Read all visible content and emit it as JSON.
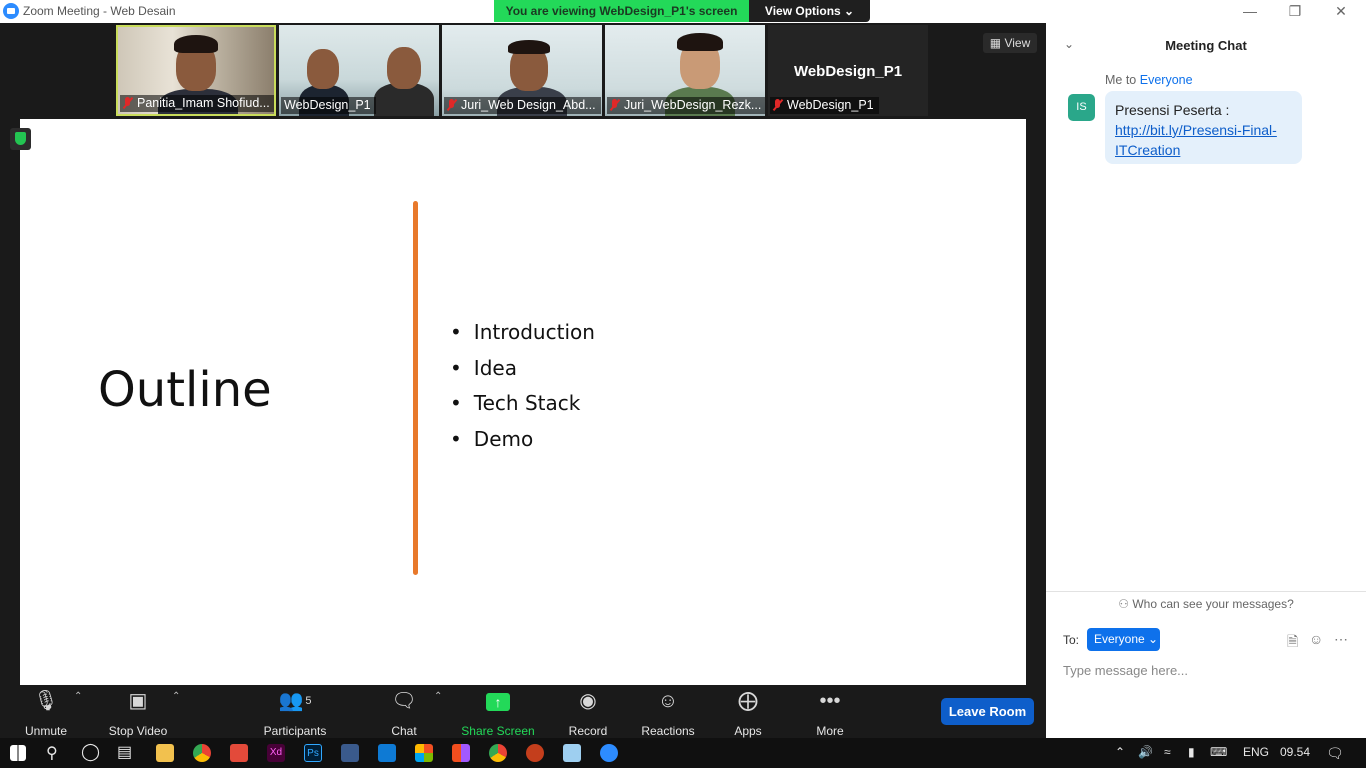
{
  "window": {
    "title": "Zoom Meeting - Web Desain",
    "banner": "You are viewing WebDesign_P1's screen",
    "view_options": "View Options ⌄",
    "controls": [
      "—",
      "❐",
      "✕"
    ]
  },
  "strip": {
    "tiles": [
      {
        "name": "Panitia_Imam Shofiud...",
        "muted": true
      },
      {
        "name": "WebDesign_P1",
        "muted": false
      },
      {
        "name": "Juri_Web Design_Abd...",
        "muted": true
      },
      {
        "name": "Juri_WebDesign_Rezk...",
        "muted": true
      },
      {
        "name": "WebDesign_P1",
        "muted": true
      }
    ],
    "empty_tile_title": "WebDesign_P1",
    "view_button": "View"
  },
  "slide": {
    "title": "Outline",
    "bullets": [
      "Introduction",
      "Idea",
      "Tech Stack",
      "Demo"
    ]
  },
  "toolbar": {
    "unmute": "Unmute",
    "stop_video": "Stop Video",
    "participants": "Participants",
    "participants_count": "5",
    "chat": "Chat",
    "share_screen": "Share Screen",
    "record": "Record",
    "reactions": "Reactions",
    "apps": "Apps",
    "more": "More",
    "leave": "Leave Room"
  },
  "chat": {
    "title": "Meeting Chat",
    "meta_from": "Me to ",
    "meta_to": "Everyone",
    "avatar": "IS",
    "message_text": "Presensi Peserta :",
    "message_link": "http://bit.ly/Presensi-Final-ITCreation",
    "who_can_see": "Who can see your messages?",
    "to_label": "To:",
    "to_value": "Everyone",
    "input_placeholder": "Type message here..."
  },
  "taskbar": {
    "lang": "ENG",
    "time": "09.54"
  },
  "colors": {
    "accent_blue": "#0e71eb",
    "share_green": "#23d959",
    "divider_orange": "#e8792b",
    "muted_red": "#e02828"
  }
}
